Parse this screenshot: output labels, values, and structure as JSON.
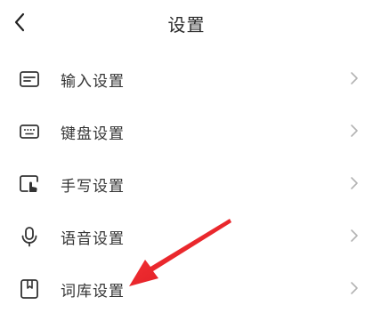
{
  "header": {
    "title": "设置"
  },
  "menu": {
    "items": [
      {
        "label": "输入设置",
        "icon": "keyboard-input-icon"
      },
      {
        "label": "键盘设置",
        "icon": "keyboard-icon"
      },
      {
        "label": "手写设置",
        "icon": "handwriting-icon"
      },
      {
        "label": "语音设置",
        "icon": "microphone-icon"
      },
      {
        "label": "词库设置",
        "icon": "dictionary-icon"
      }
    ]
  },
  "annotation": {
    "arrow_color": "#e8232d"
  }
}
